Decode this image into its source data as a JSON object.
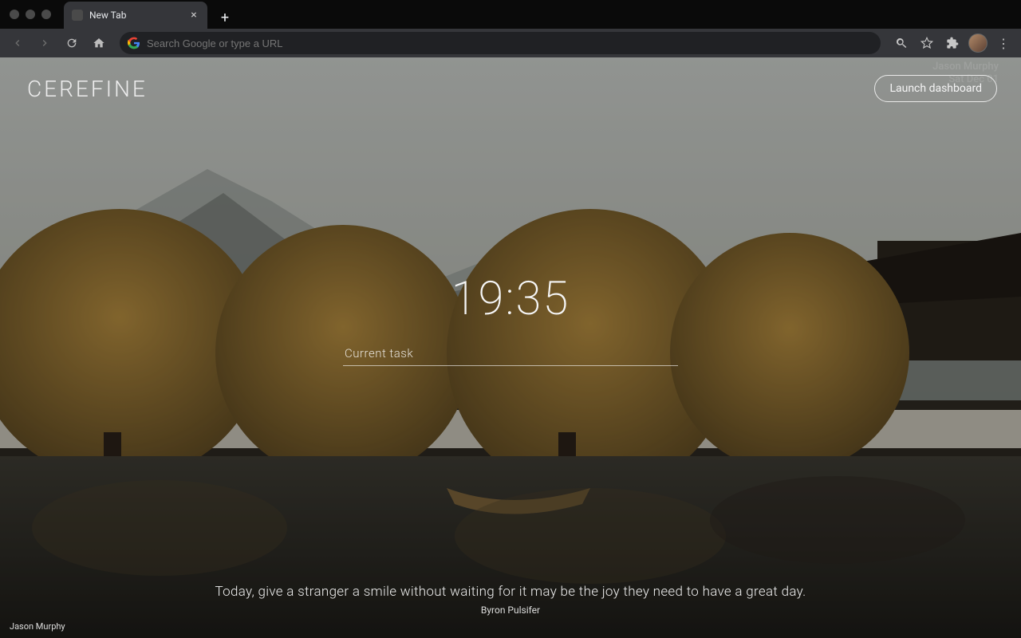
{
  "browser": {
    "tab_title": "New Tab",
    "omnibox_placeholder": "Search Google or type a URL"
  },
  "header": {
    "brand": "CEREFINE",
    "launch_label": "Launch dashboard",
    "watermark_name": "Jason Murphy",
    "watermark_line2": "Sat Dec 01"
  },
  "main": {
    "time": "19:35",
    "task_placeholder": "Current task"
  },
  "footer": {
    "quote": "Today, give a stranger a smile without waiting for it may be the joy they need to have a great day.",
    "author": "Byron Pulsifer",
    "photo_credit": "Jason Murphy"
  }
}
